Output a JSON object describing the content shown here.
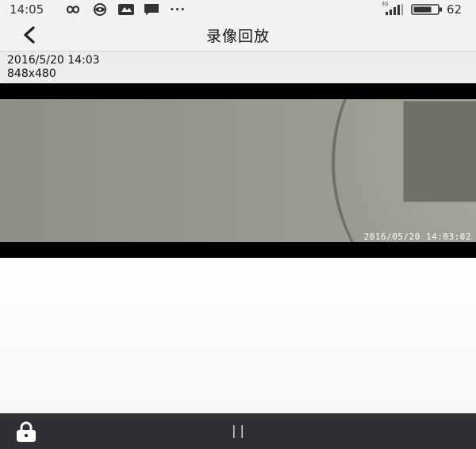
{
  "status_bar": {
    "time": "14:05",
    "icons": [
      "infinity-icon",
      "eye-icon",
      "app-badge-icon",
      "message-icon",
      "more-dots-icon"
    ],
    "more": "···",
    "battery": "62",
    "network": "3G"
  },
  "header": {
    "title": "录像回放",
    "back_icon": "chevron-left-icon"
  },
  "recording": {
    "datetime": "2016/5/20 14:03",
    "resolution": "848x480"
  },
  "video": {
    "osd_timestamp": "2016/05/20  14:03:02"
  },
  "bottom_bar": {
    "lock_icon": "lock-icon",
    "pause_label": "| |"
  },
  "colors": {
    "bar_bg": "#f2f2f2",
    "bottom_bg": "#2f2f35"
  }
}
